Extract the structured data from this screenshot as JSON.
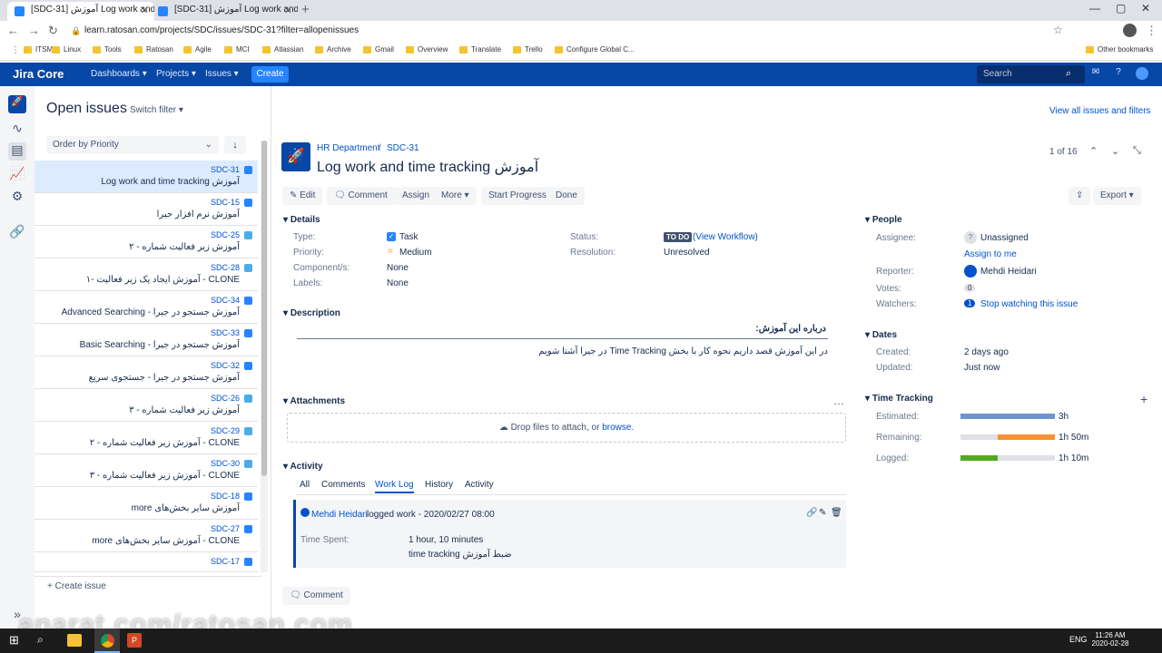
{
  "browser": {
    "tabs": [
      "[SDC-31] آموزش Log work and ti",
      "[SDC-31] آموزش Log work and ti"
    ],
    "url": "learn.ratosan.com/projects/SDC/issues/SDC-31?filter=allopenissues",
    "bookmarks": [
      "ITSM",
      "Linux",
      "Tools",
      "Ratosan",
      "Agile",
      "MCI",
      "Atlassian",
      "Archive",
      "Gmail",
      "Overview",
      "Translate",
      "Trello",
      "Configure Global C...",
      "Other bookmarks"
    ]
  },
  "jira_nav": {
    "logo": "Jira Core",
    "dashboards": "Dashboards ▾",
    "projects": "Projects ▾",
    "issues": "Issues ▾",
    "create": "Create",
    "search_placeholder": "Search"
  },
  "list": {
    "title": "Open issues",
    "switch_filter": "Switch filter ▾",
    "order": "Order by Priority",
    "create_issue": "+ Create issue",
    "items": [
      {
        "key": "SDC-31",
        "summary": "آموزش Log work and time tracking"
      },
      {
        "key": "SDC-15",
        "summary": "آموزش نرم افزار جیرا"
      },
      {
        "key": "SDC-25",
        "summary": "آموزش زیر فعالیت شماره - ۲"
      },
      {
        "key": "SDC-28",
        "summary": "CLONE - آموزش ایجاد یک زیر فعالیت -۱"
      },
      {
        "key": "SDC-34",
        "summary": "آموزش جستجو در جیرا - Advanced Searching"
      },
      {
        "key": "SDC-33",
        "summary": "آموزش جستجو در جیرا - Basic Searching"
      },
      {
        "key": "SDC-32",
        "summary": "آموزش جستجو در جیرا - جستجوی سریع"
      },
      {
        "key": "SDC-26",
        "summary": "آموزش زیر فعالیت شماره - ۳"
      },
      {
        "key": "SDC-29",
        "summary": "CLONE - آموزش زیر فعالیت شماره - ۲"
      },
      {
        "key": "SDC-30",
        "summary": "CLONE - آموزش زیر فعالیت شماره - ۳"
      },
      {
        "key": "SDC-18",
        "summary": "آموزش سایر بخش‌های more"
      },
      {
        "key": "SDC-27",
        "summary": "CLONE - آموزش سایر بخش‌های more"
      },
      {
        "key": "SDC-17",
        "summary": ""
      }
    ]
  },
  "issue": {
    "project": "HR Department",
    "key": "SDC-31",
    "title": "آموزش Log work and time tracking",
    "pager": "1 of 16",
    "view_all": "View all issues and filters",
    "buttons": {
      "edit": "Edit",
      "comment": "Comment",
      "assign": "Assign",
      "more": "More ▾",
      "start": "Start Progress",
      "done": "Done",
      "export": "Export ▾"
    },
    "details": {
      "heading": "Details",
      "type_label": "Type:",
      "type": "Task",
      "priority_label": "Priority:",
      "priority": "Medium",
      "components_label": "Component/s:",
      "components": "None",
      "labels_label": "Labels:",
      "labels": "None",
      "status_label": "Status:",
      "status": "TO DO",
      "view_workflow": "(View Workflow)",
      "resolution_label": "Resolution:",
      "resolution": "Unresolved"
    },
    "description": {
      "heading": "Description",
      "title": "درباره این آموزش:",
      "body": "در این آموزش قصد داریم نحوه کار با بخش Time Tracking در جیرا آشنا شویم"
    },
    "attachments": {
      "heading": "Attachments",
      "drop": "Drop files to attach, or",
      "browse": "browse."
    },
    "activity": {
      "heading": "Activity",
      "tabs": [
        "All",
        "Comments",
        "Work Log",
        "History",
        "Activity"
      ],
      "entry_user": "Mehdi Heidari",
      "entry_text": "logged work - 2020/02/27 08:00",
      "time_spent_label": "Time Spent:",
      "time_spent": "1 hour, 10 minutes",
      "note": "ضبط آموزش time tracking",
      "comment_btn": "Comment"
    },
    "people": {
      "heading": "People",
      "assignee_label": "Assignee:",
      "assignee": "Unassigned",
      "assign_to_me": "Assign to me",
      "reporter_label": "Reporter:",
      "reporter": "Mehdi Heidari",
      "votes_label": "Votes:",
      "votes": "0",
      "watchers_label": "Watchers:",
      "watchers": "1",
      "stop_watching": "Stop watching this issue"
    },
    "dates": {
      "heading": "Dates",
      "created_label": "Created:",
      "created": "2 days ago",
      "updated_label": "Updated:",
      "updated": "Just now"
    },
    "time_tracking": {
      "heading": "Time Tracking",
      "estimated_label": "Estimated:",
      "estimated": "3h",
      "estimated_fill": 1.0,
      "remaining_label": "Remaining:",
      "remaining": "1h 50m",
      "remaining_fill": 0.61,
      "logged_label": "Logged:",
      "logged": "1h 10m",
      "logged_fill": 0.39
    }
  },
  "taskbar": {
    "time": "11:26 AM",
    "date": "2020-02-28",
    "lang": "ENG"
  },
  "watermark": "aparat.com/ratosan.com",
  "colors": {
    "nav": "#0747a6",
    "accent": "#0052cc",
    "estimated": "#4a90d9",
    "remaining": "#f79232",
    "logged": "#51a825"
  }
}
